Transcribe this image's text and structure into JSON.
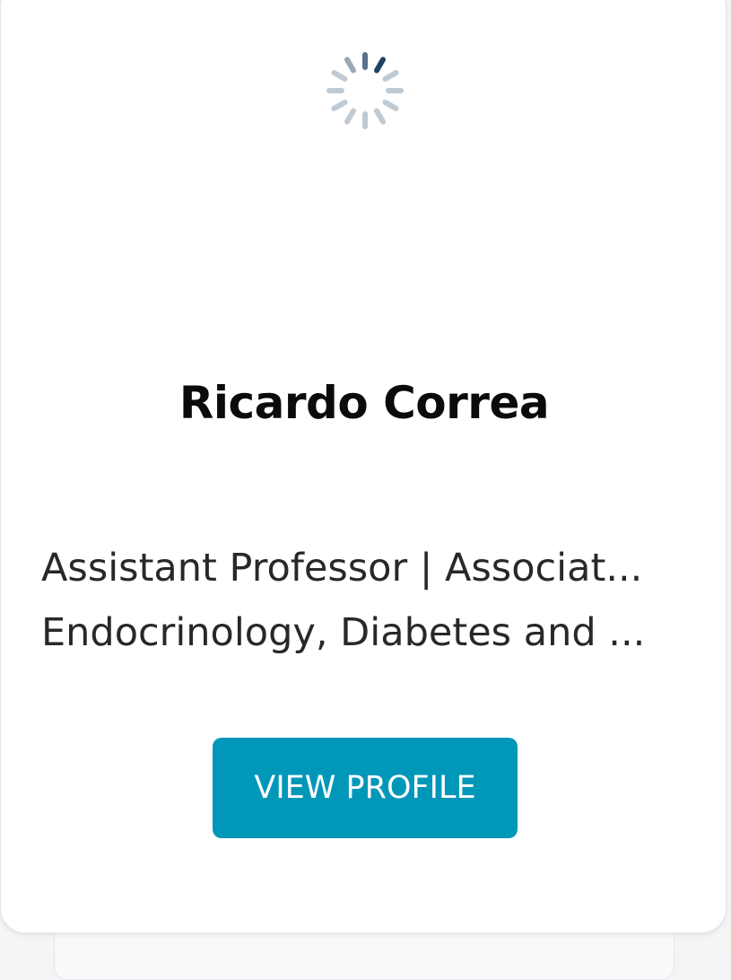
{
  "profile_card": {
    "name": "Ricardo Correa",
    "title_line_1": "Assistant Professor | Associat...",
    "title_line_2": "Endocrinology, Diabetes and ...",
    "button_label": "VIEW PROFILE",
    "loading_indicator": "spinner-icon"
  },
  "colors": {
    "button_bg": "#0097b9",
    "button_text": "#ffffff",
    "name_text": "#0b0b0b",
    "title_text": "#27282b",
    "spinner_dark": "#1f4363",
    "spinner_light": "#b9c5d0"
  }
}
